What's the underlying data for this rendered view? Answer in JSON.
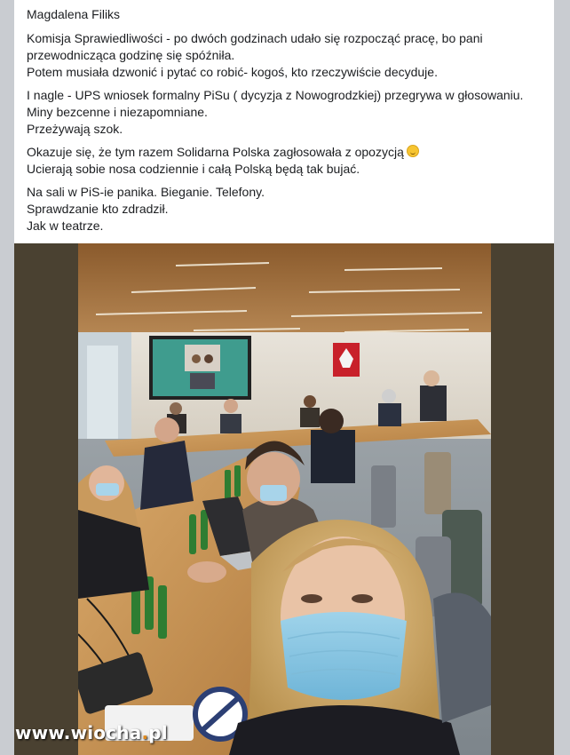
{
  "post": {
    "author": "Magdalena Filiks",
    "paragraphs": [
      {
        "lines": [
          "Komisja  Sprawiedliwości - po dwóch godzinach udało się rozpocząć pracę, bo pani",
          "przewodnicząca godzinę się spóźniła.",
          "Potem musiała dzwonić i pytać co robić- kogoś, kto rzeczywiście decyduje."
        ]
      },
      {
        "lines": [
          "I nagle - UPS wniosek formalny PiSu ( dycyzja z Nowogrodzkiej) przegrywa w głosowaniu.",
          "Miny bezcenne i niezapomniane.",
          "Przeżywają szok."
        ]
      },
      {
        "lines": [
          "Okazuje się, że tym razem Solidarna Polska zagłosowała z opozycją",
          "Ucierają sobie nosa codziennie i całą Polską będą tak bujać."
        ]
      },
      {
        "lines": [
          "Na sali w PiS-ie panika. Bieganie. Telefony.",
          "Sprawdzanie kto zdradził.",
          "Jak w teatrze."
        ]
      }
    ],
    "emoji_icon": "smiley-emoji-icon"
  },
  "watermark": {
    "prefix": "www.",
    "brand": "wiocha",
    "dot": ".",
    "tld": "pl"
  },
  "colors": {
    "background": "#c9ccd1",
    "card": "#ffffff",
    "text": "#1c1e21",
    "photo_border": "#4a4131"
  }
}
